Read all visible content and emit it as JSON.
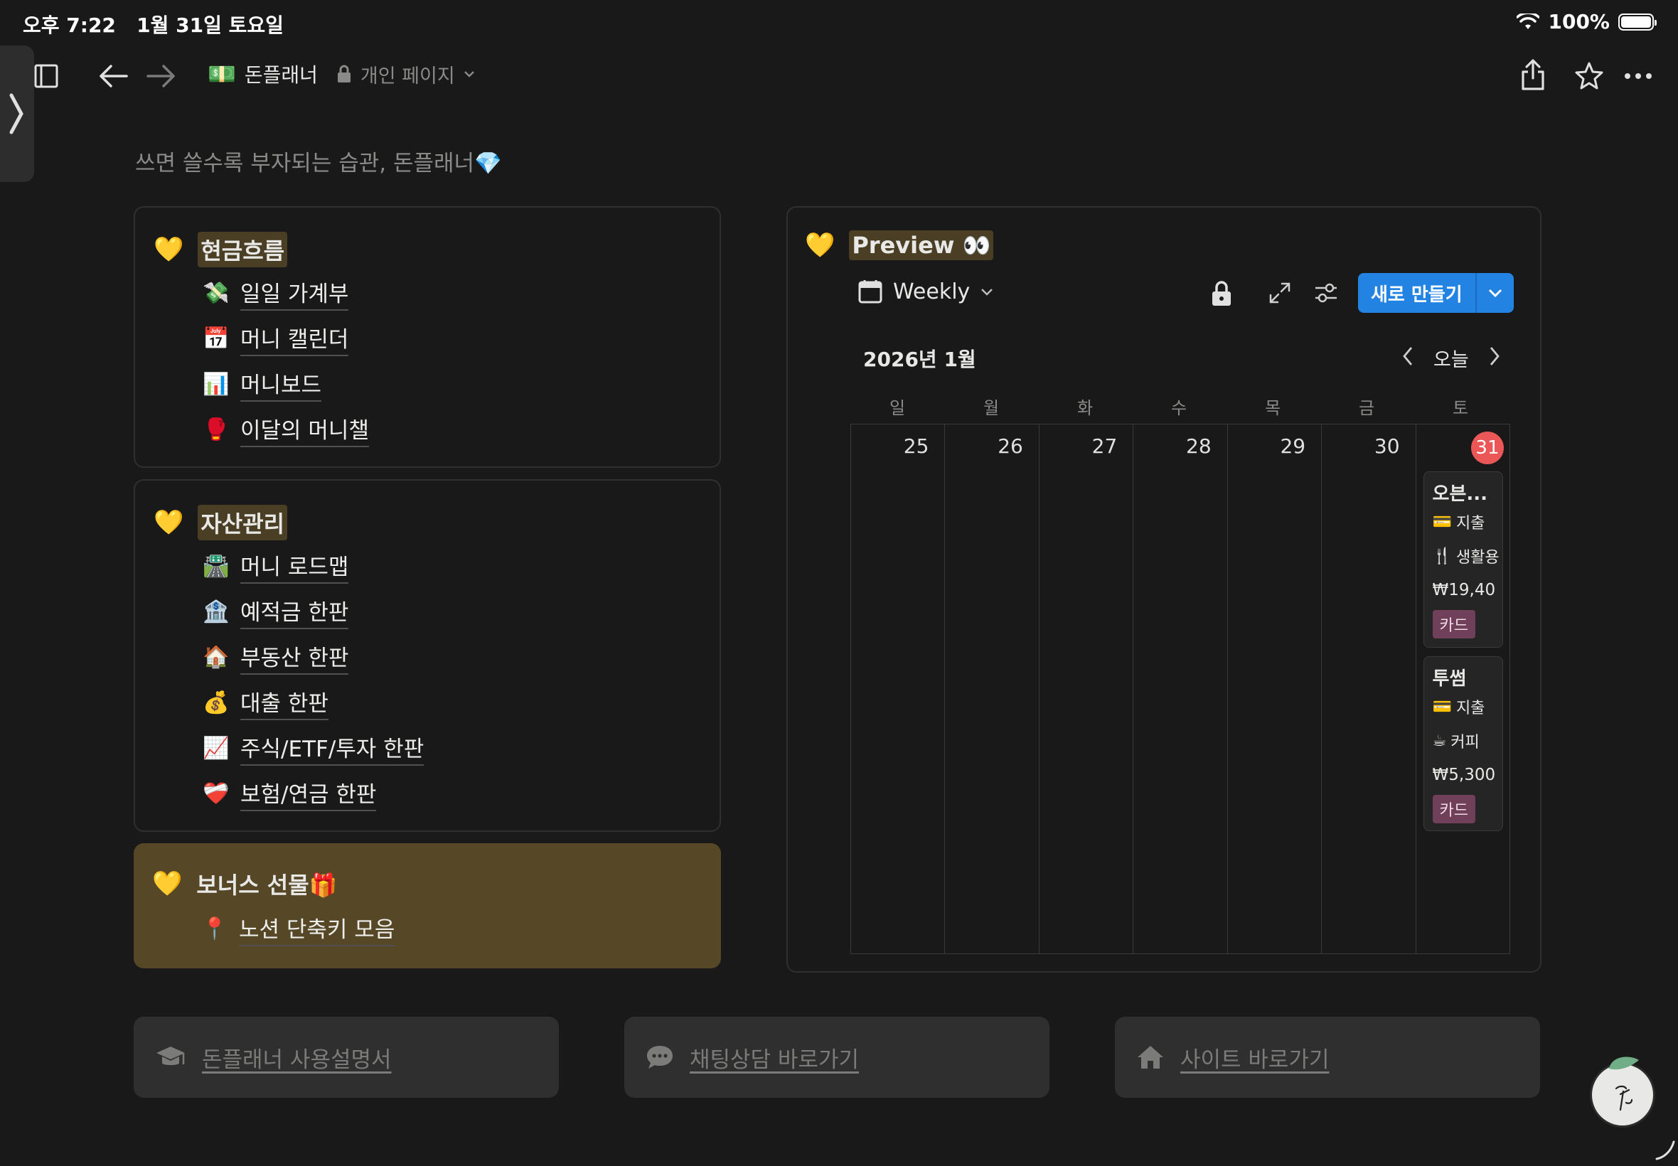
{
  "status_bar": {
    "time_date": "오후 7:22   1월 31일 토요일",
    "battery": "100%",
    "battery_level": 1.0
  },
  "breadcrumb": {
    "emoji": "💵",
    "title": "돈플래너",
    "privacy": "개인 페이지"
  },
  "tagline": "쓰면 쓸수록 부자되는 습관, 돈플래너💎",
  "cashflow": {
    "heart": "💛",
    "heading": "현금흐름",
    "items": [
      {
        "emoji": "💸",
        "label": "일일 가계부"
      },
      {
        "emoji": "📅",
        "label": "머니 캘린더"
      },
      {
        "emoji": "📊",
        "label": "머니보드"
      },
      {
        "emoji": "🥊",
        "label": "이달의 머니챌"
      }
    ]
  },
  "assets": {
    "heart": "💛",
    "heading": "자산관리",
    "items": [
      {
        "emoji": "🛣️",
        "label": "머니 로드맵"
      },
      {
        "emoji": "🏦",
        "label": "예적금 한판"
      },
      {
        "emoji": "🏠",
        "label": "부동산 한판"
      },
      {
        "emoji": "💰",
        "label": "대출 한판"
      },
      {
        "emoji": "📈",
        "label": "주식/ETF/투자 한판"
      },
      {
        "emoji": "❤️‍🩹",
        "label": "보험/연금 한판"
      }
    ]
  },
  "bonus": {
    "heart": "💛",
    "heading": "보너스 선물🎁",
    "items": [
      {
        "emoji": "📍",
        "label": "노션 단축키 모음"
      }
    ]
  },
  "preview": {
    "heart": "💛",
    "heading": "Preview 👀",
    "view_name": "Weekly",
    "new_button": "새로 만들기",
    "month_label": "2026년 1월",
    "today_label": "오늘",
    "weekdays": [
      "일",
      "월",
      "화",
      "수",
      "목",
      "금",
      "토"
    ],
    "days": [
      "25",
      "26",
      "27",
      "28",
      "29",
      "30",
      "31"
    ],
    "today": "31",
    "events": [
      {
        "title": "오븐...",
        "type_emoji": "💳",
        "type": "지출",
        "cat_emoji": "🍴",
        "category": "생활용",
        "amount": "₩19,40",
        "tag": "카드"
      },
      {
        "title": "투썸",
        "type_emoji": "💳",
        "type": "지출",
        "cat_emoji": "☕",
        "category": "커피",
        "amount": "₩5,300",
        "tag": "카드"
      }
    ]
  },
  "footer": {
    "buttons": [
      {
        "icon": "graduation-cap-icon",
        "label": "돈플래너 사용설명서"
      },
      {
        "icon": "chat-bubble-icon",
        "label": "채팅상담 바로가기"
      },
      {
        "icon": "home-icon",
        "label": "사이트 바로가기"
      }
    ]
  },
  "colors": {
    "background": "#191919",
    "accent": "#2383e2",
    "today": "#eb5757",
    "bonus_bg": "#564827",
    "tag_bg": "#70405a"
  }
}
